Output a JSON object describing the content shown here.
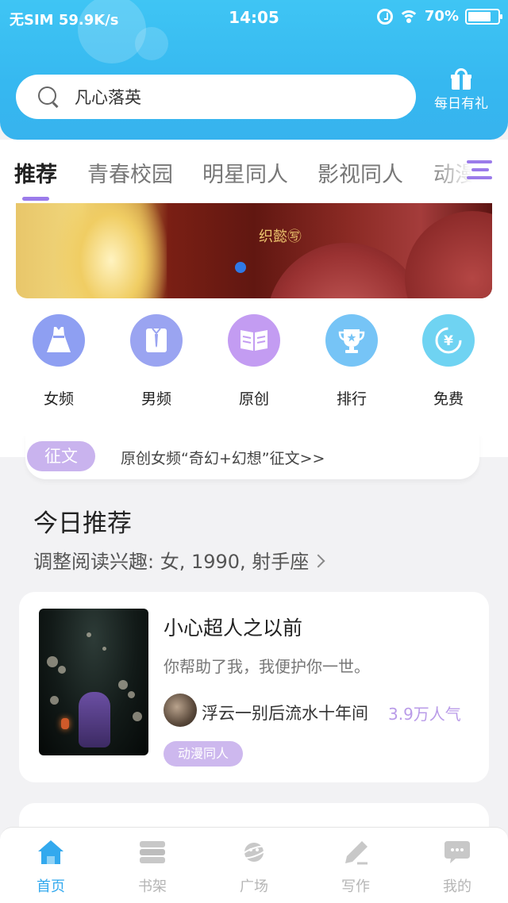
{
  "status_bar": {
    "carrier": "无SIM",
    "speed": "59.9K/s",
    "time": "14:05",
    "battery": "70%"
  },
  "search": {
    "placeholder": "凡心落英"
  },
  "daily_gift": {
    "label": "每日有礼"
  },
  "tabs": [
    {
      "label": "推荐",
      "active": true
    },
    {
      "label": "青春校园",
      "active": false
    },
    {
      "label": "明星同人",
      "active": false
    },
    {
      "label": "影视同人",
      "active": false
    },
    {
      "label": "动漫",
      "active": false
    }
  ],
  "banner": {
    "author": "织懿㊢"
  },
  "categories": [
    {
      "label": "女频",
      "icon": "dress-icon",
      "color": "#8e9ff2"
    },
    {
      "label": "男频",
      "icon": "shirt-icon",
      "color": "#9aa4f1"
    },
    {
      "label": "原创",
      "icon": "book-icon",
      "color": "#c39cf2"
    },
    {
      "label": "排行",
      "icon": "trophy-icon",
      "color": "#76c4f6"
    },
    {
      "label": "免费",
      "icon": "yuan-coin-icon",
      "color": "#6fd3f2"
    }
  ],
  "contest": {
    "badge": "征文",
    "text": "原创女频“奇幻+幻想”征文>>"
  },
  "recommendation": {
    "title": "今日推荐",
    "subtitle": "调整阅读兴趣: 女, 1990, 射手座"
  },
  "books": [
    {
      "title": "小心超人之以前",
      "description": "你帮助了我，我便护你一世。",
      "author": "浮云一别后流水十年间",
      "popularity": "3.9万人气",
      "tag": "动漫同人"
    }
  ],
  "bottom_nav": [
    {
      "label": "首页",
      "icon": "home-icon",
      "active": true
    },
    {
      "label": "书架",
      "icon": "bookshelf-icon",
      "active": false
    },
    {
      "label": "广场",
      "icon": "planet-icon",
      "active": false
    },
    {
      "label": "写作",
      "icon": "pen-icon",
      "active": false
    },
    {
      "label": "我的",
      "icon": "chat-bubble-icon",
      "active": false
    }
  ],
  "colors": {
    "header": "#3ec2f3",
    "accent_purple": "#9b7bea",
    "nav_active": "#33a9ee"
  }
}
